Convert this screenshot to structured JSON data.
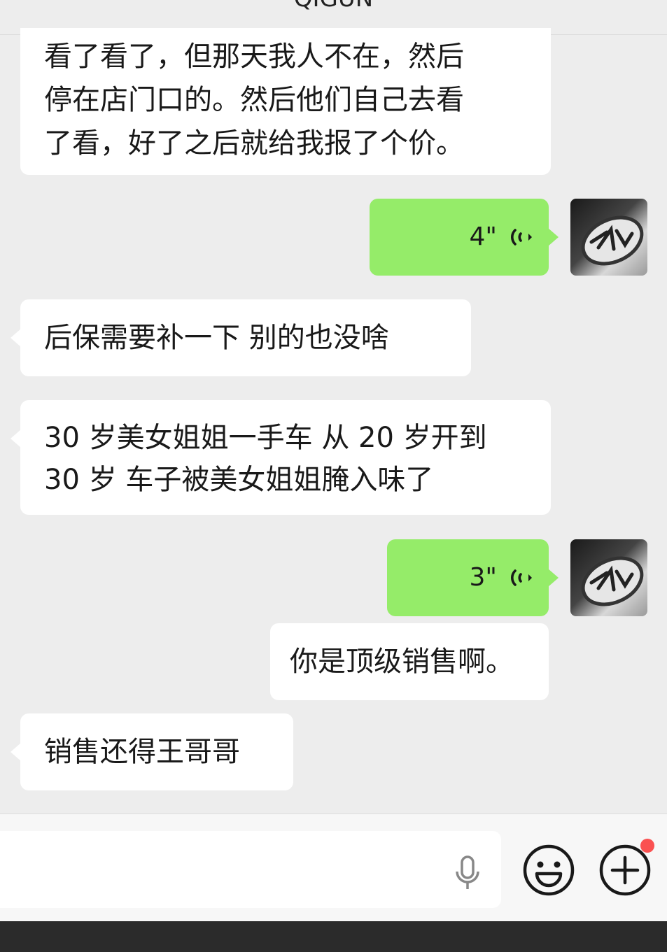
{
  "header": {
    "title": "QIGUN"
  },
  "messages": [
    {
      "lines": [
        "看了看了，但那天我人不在，然后",
        "停在店门口的。然后他们自己去看",
        "了看，好了之后就给我报了个价。"
      ]
    },
    {
      "duration": "4\""
    },
    {
      "text": "后保需要补一下 别的也没啥"
    },
    {
      "lines": [
        "30 岁美女姐姐一手车  从 20 岁开到",
        "30 岁  车子被美女姐姐腌入味了"
      ]
    },
    {
      "duration": "3\""
    },
    {
      "text": "你是顶级销售啊。"
    },
    {
      "text": "销售还得王哥哥"
    }
  ],
  "composer": {
    "mic_icon": "microphone-icon",
    "emoji_icon": "smiley-icon",
    "plus_icon": "plus-circle-icon",
    "badge_color": "#fa5151"
  },
  "colors": {
    "outgoing": "#95ec69",
    "incoming": "#ffffff",
    "background": "#ededed"
  }
}
